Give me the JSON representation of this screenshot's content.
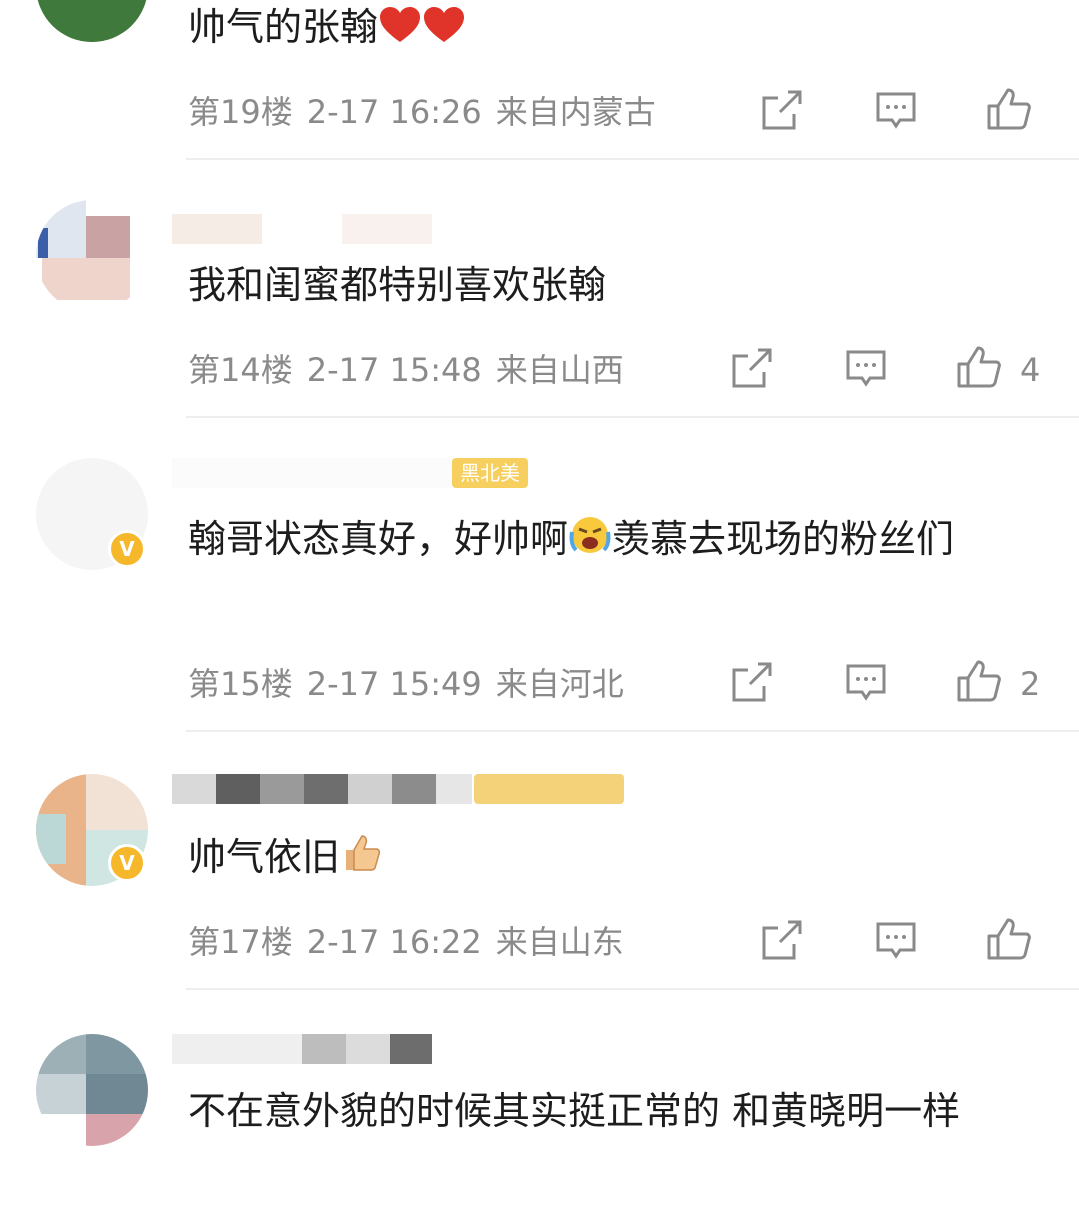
{
  "comments": [
    {
      "text": "帅气的张翰",
      "floor": "第19楼",
      "time": "2-17 16:26",
      "location": "来自内蒙古",
      "likes": ""
    },
    {
      "text": "我和闺蜜都特别喜欢张翰",
      "floor": "第14楼",
      "time": "2-17 15:48",
      "location": "来自山西",
      "likes": "4"
    },
    {
      "tag": "黑北美",
      "text": "翰哥状态真好，好帅啊",
      "text_after": "羡慕去现场的粉丝们",
      "floor": "第15楼",
      "time": "2-17 15:49",
      "location": "来自河北",
      "likes": "2"
    },
    {
      "text": "帅气依旧",
      "floor": "第17楼",
      "time": "2-17 16:22",
      "location": "来自山东",
      "likes": ""
    },
    {
      "text": "不在意外貌的时候其实挺正常的 和黄晓明一样"
    }
  ],
  "icons": {
    "share": "share-icon",
    "comment": "comment-icon",
    "like": "thumbs-up-icon",
    "heart": "heart-emoji",
    "crying": "crying-laughing-emoji",
    "thumbs_emoji": "thumbs-up-emoji"
  },
  "colors": {
    "meta_text": "#8a8a8a",
    "verified_badge": "#f6b82a",
    "tag_bg": "#f7cf5e",
    "heart": "#e0342a"
  }
}
